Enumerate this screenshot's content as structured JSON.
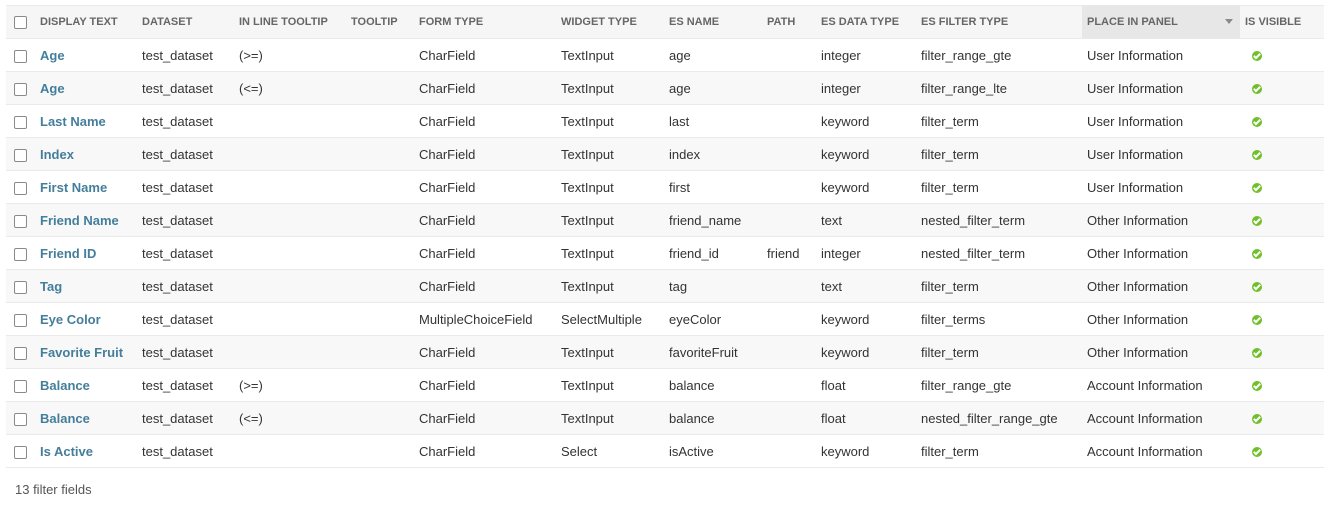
{
  "table": {
    "headers": {
      "display_text": "DISPLAY TEXT",
      "dataset": "DATASET",
      "in_line_tooltip": "IN LINE TOOLTIP",
      "tooltip": "TOOLTIP",
      "form_type": "FORM TYPE",
      "widget_type": "WIDGET TYPE",
      "es_name": "ES NAME",
      "path": "PATH",
      "es_data_type": "ES DATA TYPE",
      "es_filter_type": "ES FILTER TYPE",
      "place_in_panel": "PLACE IN PANEL",
      "is_visible": "IS VISIBLE"
    },
    "sorted_column": "place_in_panel",
    "rows": [
      {
        "display_text": "Age",
        "dataset": "test_dataset",
        "in_line_tooltip": "(>=)",
        "tooltip": "",
        "form_type": "CharField",
        "widget_type": "TextInput",
        "es_name": "age",
        "path": "",
        "es_data_type": "integer",
        "es_filter_type": "filter_range_gte",
        "place_in_panel": "User Information",
        "is_visible": "check-icon"
      },
      {
        "display_text": "Age",
        "dataset": "test_dataset",
        "in_line_tooltip": "(<=)",
        "tooltip": "",
        "form_type": "CharField",
        "widget_type": "TextInput",
        "es_name": "age",
        "path": "",
        "es_data_type": "integer",
        "es_filter_type": "filter_range_lte",
        "place_in_panel": "User Information",
        "is_visible": "check-icon"
      },
      {
        "display_text": "Last Name",
        "dataset": "test_dataset",
        "in_line_tooltip": "",
        "tooltip": "",
        "form_type": "CharField",
        "widget_type": "TextInput",
        "es_name": "last",
        "path": "",
        "es_data_type": "keyword",
        "es_filter_type": "filter_term",
        "place_in_panel": "User Information",
        "is_visible": "check-icon"
      },
      {
        "display_text": "Index",
        "dataset": "test_dataset",
        "in_line_tooltip": "",
        "tooltip": "",
        "form_type": "CharField",
        "widget_type": "TextInput",
        "es_name": "index",
        "path": "",
        "es_data_type": "keyword",
        "es_filter_type": "filter_term",
        "place_in_panel": "User Information",
        "is_visible": "check-icon"
      },
      {
        "display_text": "First Name",
        "dataset": "test_dataset",
        "in_line_tooltip": "",
        "tooltip": "",
        "form_type": "CharField",
        "widget_type": "TextInput",
        "es_name": "first",
        "path": "",
        "es_data_type": "keyword",
        "es_filter_type": "filter_term",
        "place_in_panel": "User Information",
        "is_visible": "check-icon"
      },
      {
        "display_text": "Friend Name",
        "dataset": "test_dataset",
        "in_line_tooltip": "",
        "tooltip": "",
        "form_type": "CharField",
        "widget_type": "TextInput",
        "es_name": "friend_name",
        "path": "",
        "es_data_type": "text",
        "es_filter_type": "nested_filter_term",
        "place_in_panel": "Other Information",
        "is_visible": "check-icon"
      },
      {
        "display_text": "Friend ID",
        "dataset": "test_dataset",
        "in_line_tooltip": "",
        "tooltip": "",
        "form_type": "CharField",
        "widget_type": "TextInput",
        "es_name": "friend_id",
        "path": "friend",
        "es_data_type": "integer",
        "es_filter_type": "nested_filter_term",
        "place_in_panel": "Other Information",
        "is_visible": "check-icon"
      },
      {
        "display_text": "Tag",
        "dataset": "test_dataset",
        "in_line_tooltip": "",
        "tooltip": "",
        "form_type": "CharField",
        "widget_type": "TextInput",
        "es_name": "tag",
        "path": "",
        "es_data_type": "text",
        "es_filter_type": "filter_term",
        "place_in_panel": "Other Information",
        "is_visible": "check-icon"
      },
      {
        "display_text": "Eye Color",
        "dataset": "test_dataset",
        "in_line_tooltip": "",
        "tooltip": "",
        "form_type": "MultipleChoiceField",
        "widget_type": "SelectMultiple",
        "es_name": "eyeColor",
        "path": "",
        "es_data_type": "keyword",
        "es_filter_type": "filter_terms",
        "place_in_panel": "Other Information",
        "is_visible": "check-icon"
      },
      {
        "display_text": "Favorite Fruit",
        "dataset": "test_dataset",
        "in_line_tooltip": "",
        "tooltip": "",
        "form_type": "CharField",
        "widget_type": "TextInput",
        "es_name": "favoriteFruit",
        "path": "",
        "es_data_type": "keyword",
        "es_filter_type": "filter_term",
        "place_in_panel": "Other Information",
        "is_visible": "check-icon"
      },
      {
        "display_text": "Balance",
        "dataset": "test_dataset",
        "in_line_tooltip": "(>=)",
        "tooltip": "",
        "form_type": "CharField",
        "widget_type": "TextInput",
        "es_name": "balance",
        "path": "",
        "es_data_type": "float",
        "es_filter_type": "filter_range_gte",
        "place_in_panel": "Account Information",
        "is_visible": "check-icon"
      },
      {
        "display_text": "Balance",
        "dataset": "test_dataset",
        "in_line_tooltip": "(<=)",
        "tooltip": "",
        "form_type": "CharField",
        "widget_type": "TextInput",
        "es_name": "balance",
        "path": "",
        "es_data_type": "float",
        "es_filter_type": "nested_filter_range_gte",
        "place_in_panel": "Account Information",
        "is_visible": "check-icon"
      },
      {
        "display_text": "Is Active",
        "dataset": "test_dataset",
        "in_line_tooltip": "",
        "tooltip": "",
        "form_type": "CharField",
        "widget_type": "Select",
        "es_name": "isActive",
        "path": "",
        "es_data_type": "keyword",
        "es_filter_type": "filter_term",
        "place_in_panel": "Account Information",
        "is_visible": "check-icon"
      }
    ]
  },
  "footer": {
    "count_text": "13 filter fields"
  },
  "colors": {
    "link": "#447e9b",
    "visible_icon": "#70bf2b",
    "header_bg": "#f6f6f6",
    "sorted_header_bg": "#e7e7e7"
  }
}
